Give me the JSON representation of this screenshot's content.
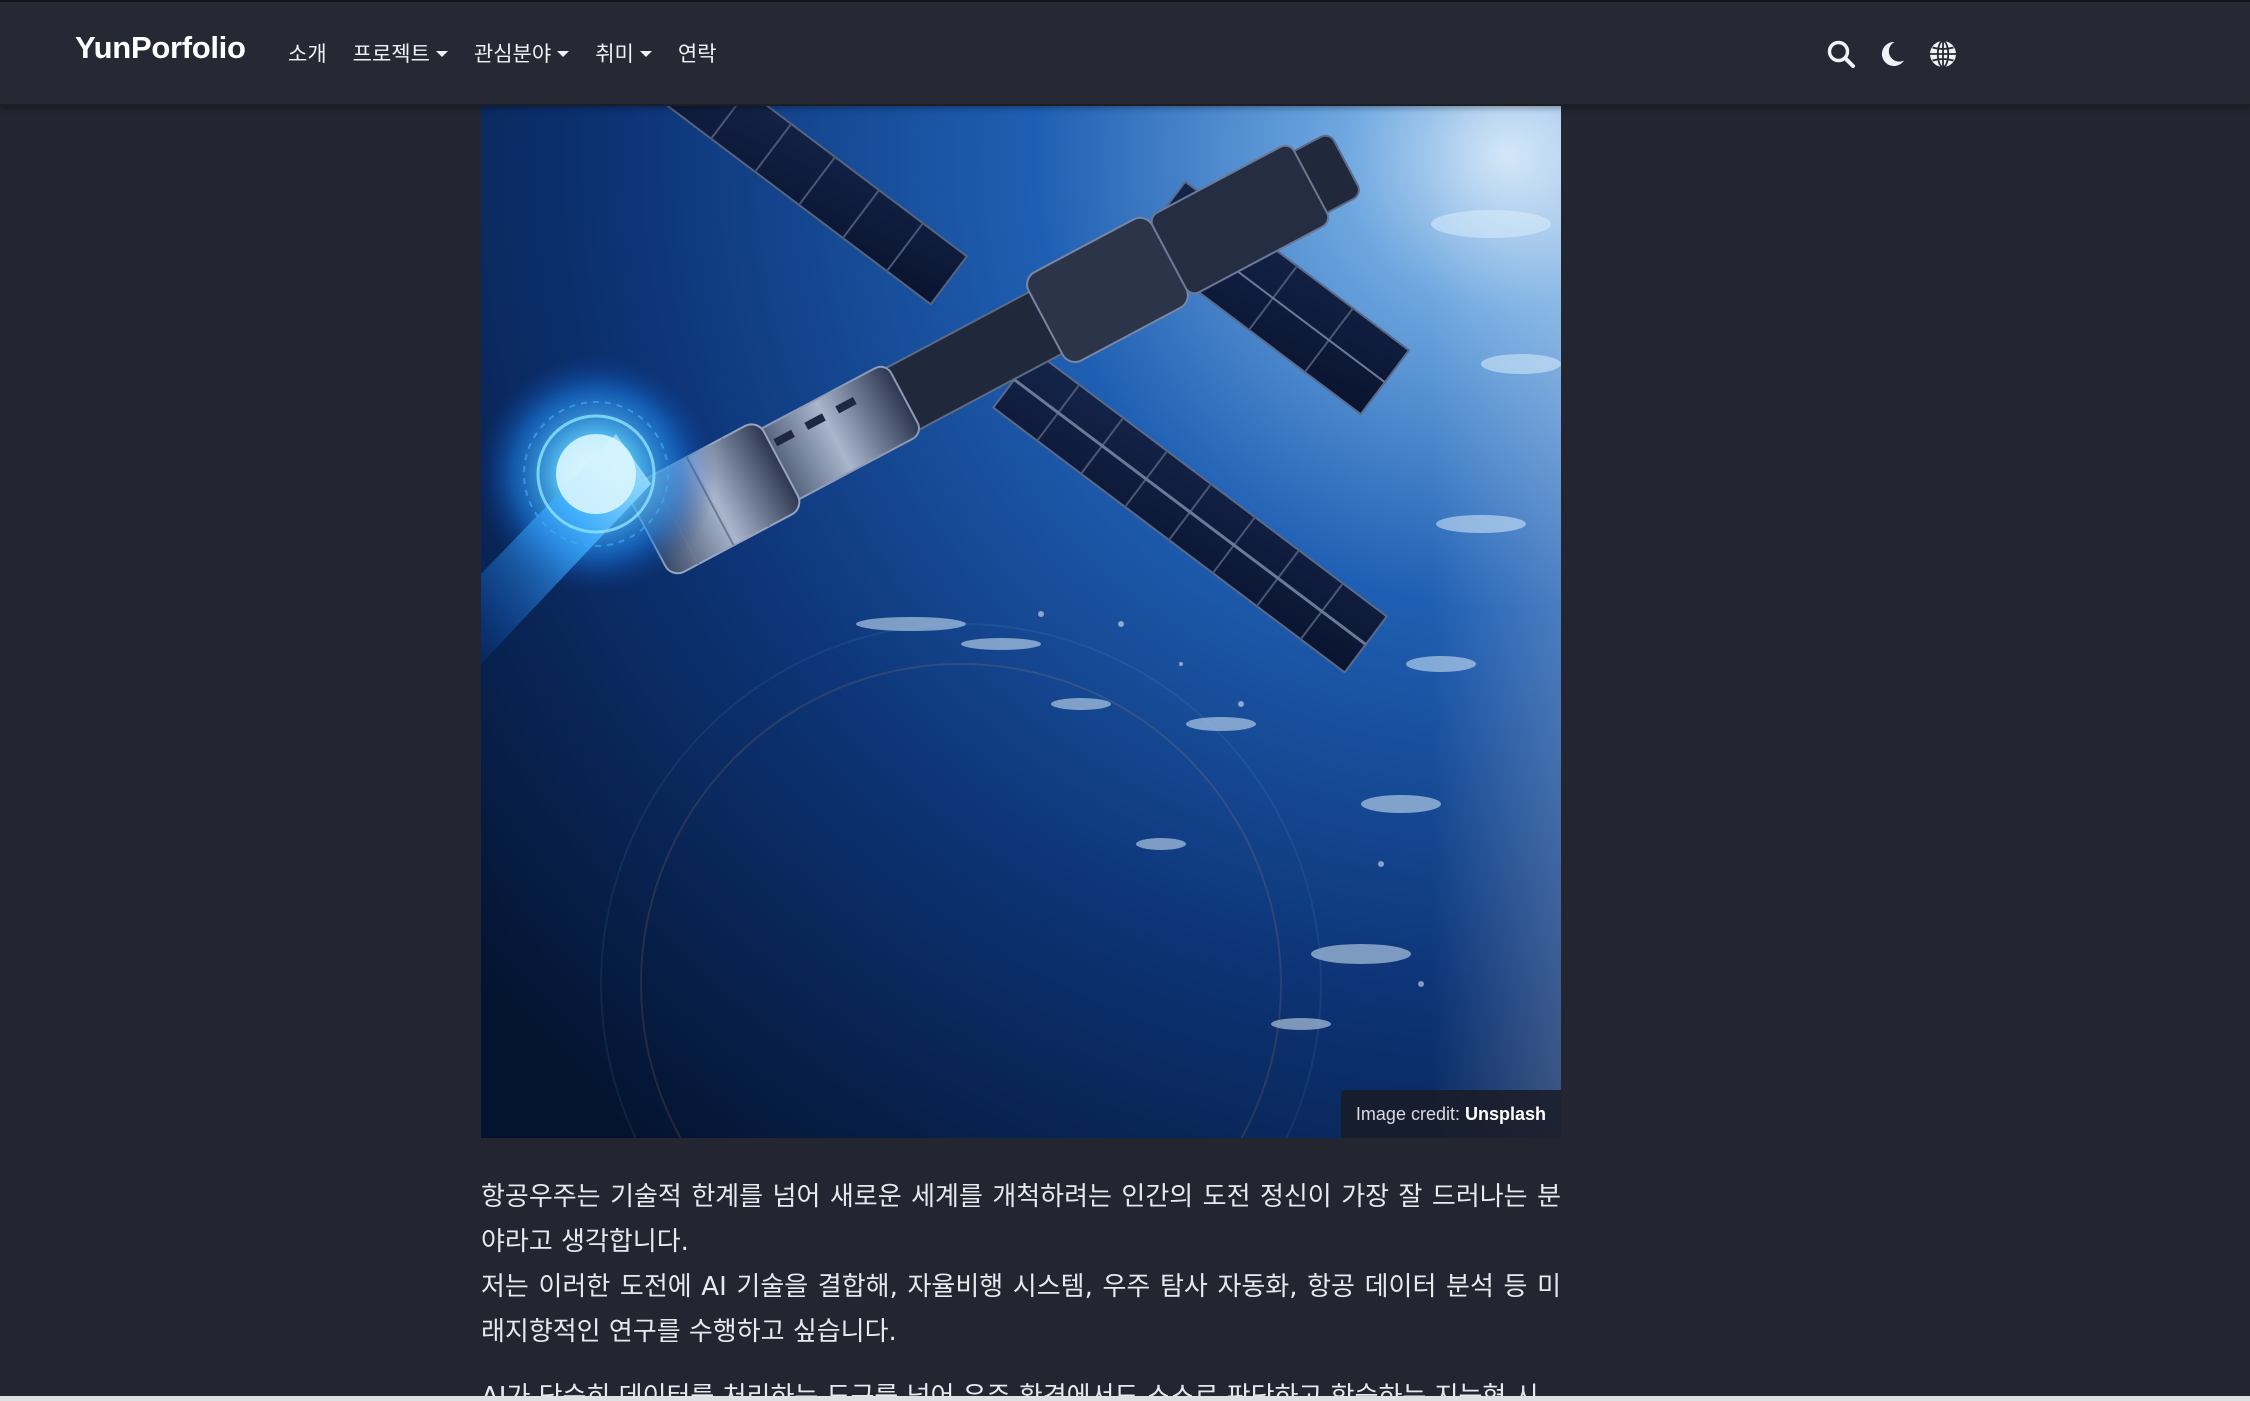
{
  "brand": {
    "name": "YunPorfolio"
  },
  "nav": {
    "items": [
      {
        "label": "소개",
        "dropdown": false
      },
      {
        "label": "프로젝트",
        "dropdown": true
      },
      {
        "label": "관심분야",
        "dropdown": true
      },
      {
        "label": "취미",
        "dropdown": true
      },
      {
        "label": "연락",
        "dropdown": false
      }
    ],
    "icons": [
      "search-icon",
      "moon-icon",
      "globe-icon"
    ]
  },
  "hero": {
    "image": "space-station-orbiting-earth",
    "credit_prefix": "Image credit:",
    "credit_source": "Unsplash"
  },
  "article": {
    "paragraph_1": "항공우주는 기술적 한계를 넘어 새로운 세계를 개척하려는 인간의 도전 정신이 가장 잘 드러나는 분야라고 생각합니다.",
    "paragraph_2": "저는 이러한 도전에 AI 기술을 결합해, 자율비행 시스템, 우주 탐사 자동화, 항공 데이터 분석 등 미래지향적인 연구를 수행하고 싶습니다.",
    "paragraph_3_partial": "AI가 단순히 데이터를 처리하는 도구를 넘어 우주 환경에서도 스스로 판단하고 학습하는 지능형 시"
  },
  "colors": {
    "background": "#232530",
    "navbar": "#262833",
    "text": "#e8e9ed"
  }
}
